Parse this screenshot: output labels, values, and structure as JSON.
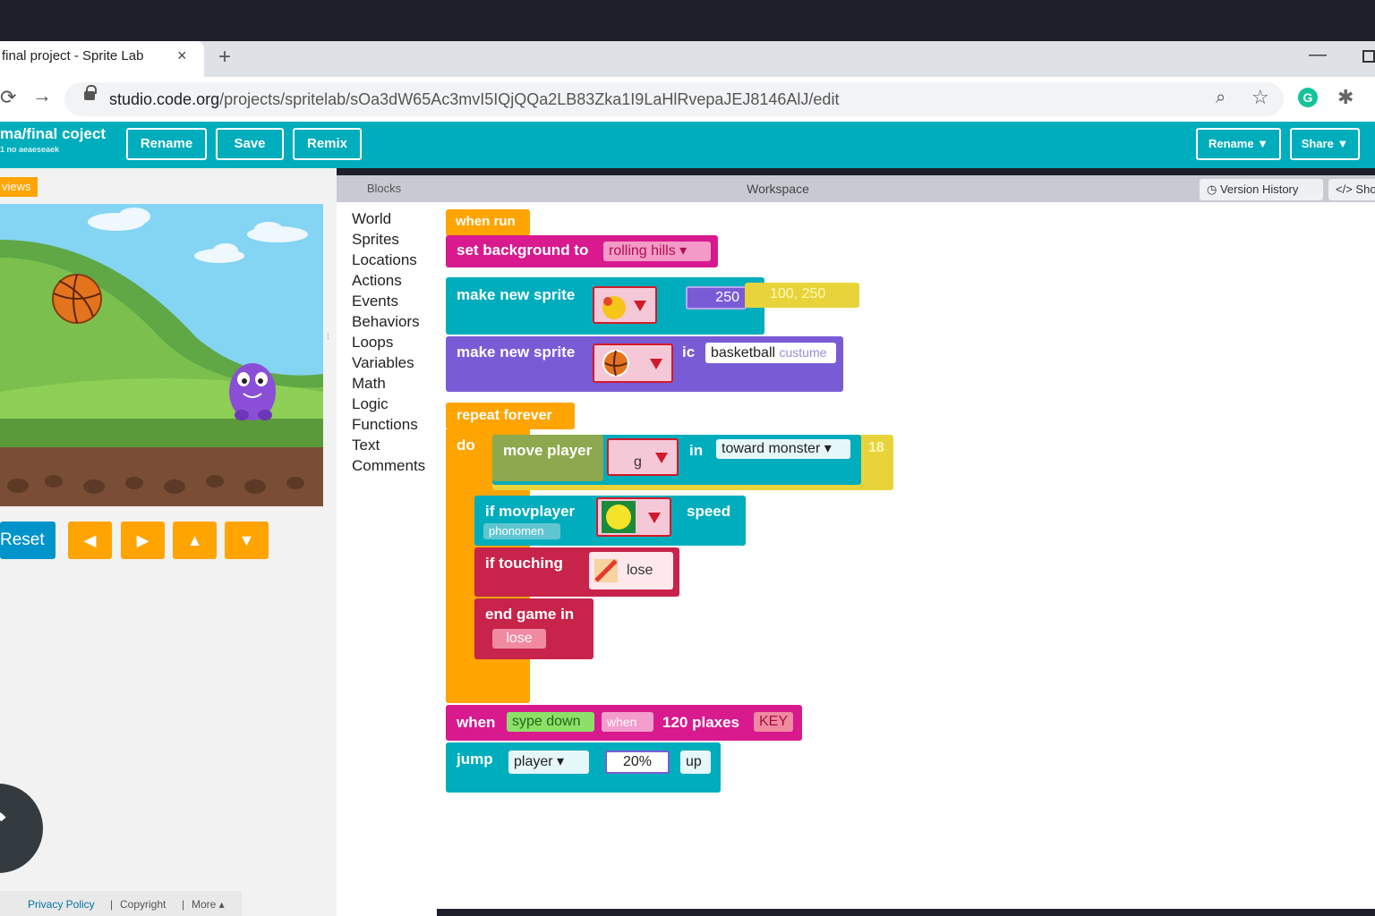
{
  "browser": {
    "tab_title": "final project - Sprite Lab",
    "tab_close": "×",
    "new_tab": "+",
    "url_host": "studio.code.org",
    "url_path": "/projects/spritelab/sOa3dW65Ac3mvI5IQjQQa2LB83Zka1I9LaHlRvepaJEJ8146AlJ/edit"
  },
  "header": {
    "project_title": "ma/final coject",
    "project_subtitle": "1 no aeaeseaek",
    "buttons": [
      "Rename",
      "Save",
      "Remix"
    ],
    "right_buttons": [
      "Rename",
      "Share"
    ]
  },
  "stage": {
    "reviews_tab": "views",
    "reset_label": "Reset",
    "arrows": [
      "◀",
      "▶",
      "▲",
      "▼"
    ]
  },
  "footer": {
    "privacy": "Privacy Policy",
    "copyright": "Copyright",
    "more": "More ▴",
    "sep": "|"
  },
  "toolbox": {
    "header": "Blocks",
    "categories": [
      "World",
      "Sprites",
      "Locations",
      "Actions",
      "Events",
      "Behaviors",
      "Loops",
      "Variables",
      "Math",
      "Logic",
      "Functions",
      "Text",
      "Comments"
    ]
  },
  "workspace": {
    "header": "Workspace",
    "version_history": "Version History",
    "show_code": "Sho",
    "blocks": {
      "when_run": "when run",
      "set_background": "set background to",
      "background_value": "rolling hills",
      "make_sprite_1": "make new sprite",
      "make_sprite_1_num": "250",
      "make_sprite_1_pos": "100, 250",
      "make_sprite_2": "make new sprite",
      "make_sprite_2_in": "ic",
      "make_sprite_2_costume": "basketball",
      "make_sprite_2_costume_suffix": "custume",
      "repeat_forever": "repeat forever",
      "do": "do",
      "move_player": "move player",
      "move_letter": "g",
      "move_in": "in",
      "toward_monster": "toward monster",
      "move_num": "18",
      "if_movplayer": "if  movplayer",
      "phonomen": "phonomen",
      "speed": "speed",
      "if_touching": "if  touching",
      "lose_1": "lose",
      "end_game_in": "end game  in",
      "lose_2": "lose",
      "when": "when",
      "sype_down": "sype down",
      "when_ghost": "when",
      "plaxes": "120  plaxes",
      "key": "KEY",
      "jump": "jump",
      "player": "player",
      "percent": "20%",
      "up": "up"
    }
  },
  "colors": {
    "teal": "#00adbc",
    "orange": "#ffa400",
    "magenta": "#d81a8e",
    "purple": "#7a5bd6",
    "crimson": "#c8234a",
    "olive": "#8da84e",
    "yellow": "#e8d43a"
  }
}
